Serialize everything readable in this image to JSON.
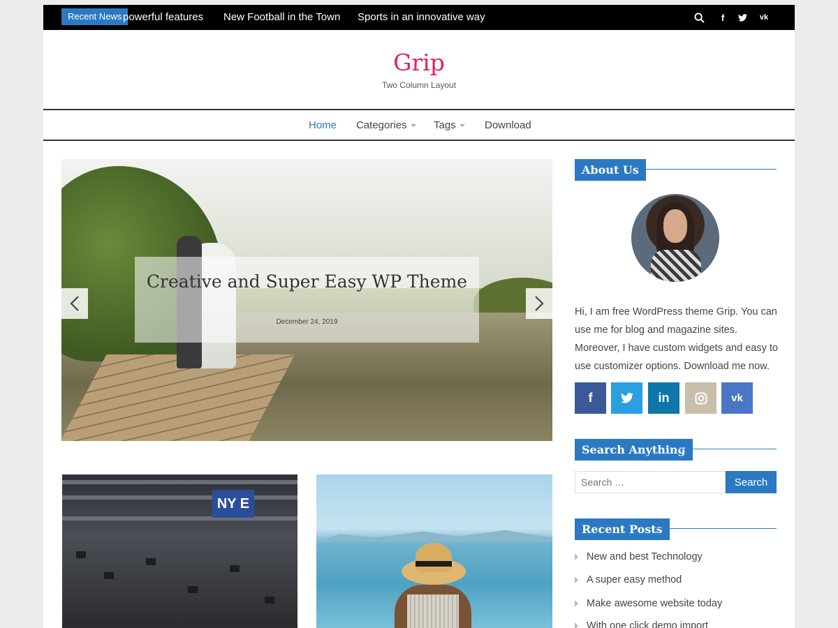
{
  "topbar": {
    "badge": "Recent News",
    "ticker": [
      "powerful features",
      "New Football in the Town",
      "Sports in an innovative way"
    ],
    "icons": [
      "search-icon",
      "facebook-icon",
      "twitter-icon",
      "vk-icon"
    ]
  },
  "header": {
    "title": "Grip",
    "tagline": "Two Column Layout"
  },
  "nav": {
    "items": [
      {
        "label": "Home",
        "active": true
      },
      {
        "label": "Categories",
        "dropdown": true
      },
      {
        "label": "Tags",
        "dropdown": true
      },
      {
        "label": "Download"
      }
    ]
  },
  "slider": {
    "title": "Creative and Super Easy WP Theme",
    "date": "December 24, 2019",
    "prev_icon": "chevron-left-icon",
    "next_icon": "chevron-right-icon"
  },
  "posts": {
    "thumb_1_text": "NY E"
  },
  "sidebar": {
    "about": {
      "heading": "About Us",
      "text": "Hi, I am free WordPress theme Grip. You can use me for blog and magazine sites. Moreover, I have custom widgets and easy to use customizer options. Download me now.",
      "social": [
        {
          "icon": "facebook-icon",
          "glyph": "f",
          "color": "#3b5998"
        },
        {
          "icon": "twitter-icon",
          "glyph": "t",
          "color": "#2b9fe0"
        },
        {
          "icon": "linkedin-icon",
          "glyph": "in",
          "color": "#0e76a8"
        },
        {
          "icon": "instagram-icon",
          "glyph": "◎",
          "color": "#c9beaa"
        },
        {
          "icon": "vk-icon",
          "glyph": "vk",
          "color": "#4a76c6"
        }
      ]
    },
    "search": {
      "heading": "Search Anything",
      "placeholder": "Search …",
      "button": "Search"
    },
    "recent": {
      "heading": "Recent Posts",
      "items": [
        "New and best Technology",
        "A super easy method",
        "Make awesome website today",
        "With one click demo import"
      ]
    }
  },
  "colors": {
    "accent": "#2b79c2",
    "brand": "#e21f62",
    "topbar": "#000000"
  }
}
